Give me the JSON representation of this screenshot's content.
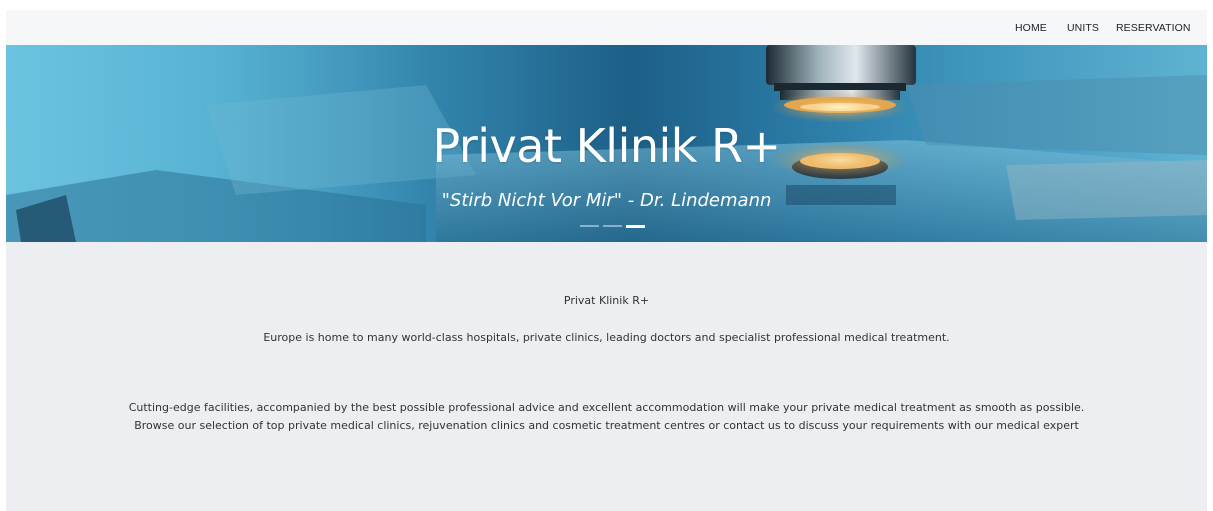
{
  "nav": {
    "items": [
      {
        "label": "HOME"
      },
      {
        "label": "UNITS"
      },
      {
        "label": "RESERVATION"
      }
    ]
  },
  "hero": {
    "title": "Privat Klinik R+",
    "subtitle": "\"Stirb Nicht Vor Mir\" - Dr. Lindemann",
    "slide_count": 3,
    "active_slide": 3
  },
  "content": {
    "title": "Privat Klinik R+",
    "intro": "Europe is home to many world-class hospitals, private clinics, leading doctors and specialist professional medical treatment.",
    "body": "Cutting-edge facilities, accompanied by the best possible professional advice and excellent accommodation will make your private medical treatment as smooth as possible. Browse our selection of top private medical clinics, rejuvenation clinics and cosmetic treatment centres or contact us to discuss your requirements with our medical expert"
  },
  "colors": {
    "page_background": "#eceef1",
    "navbar_background": "#f6f7f9",
    "hero_accent": "#2f7fa7",
    "text": "#333333"
  }
}
